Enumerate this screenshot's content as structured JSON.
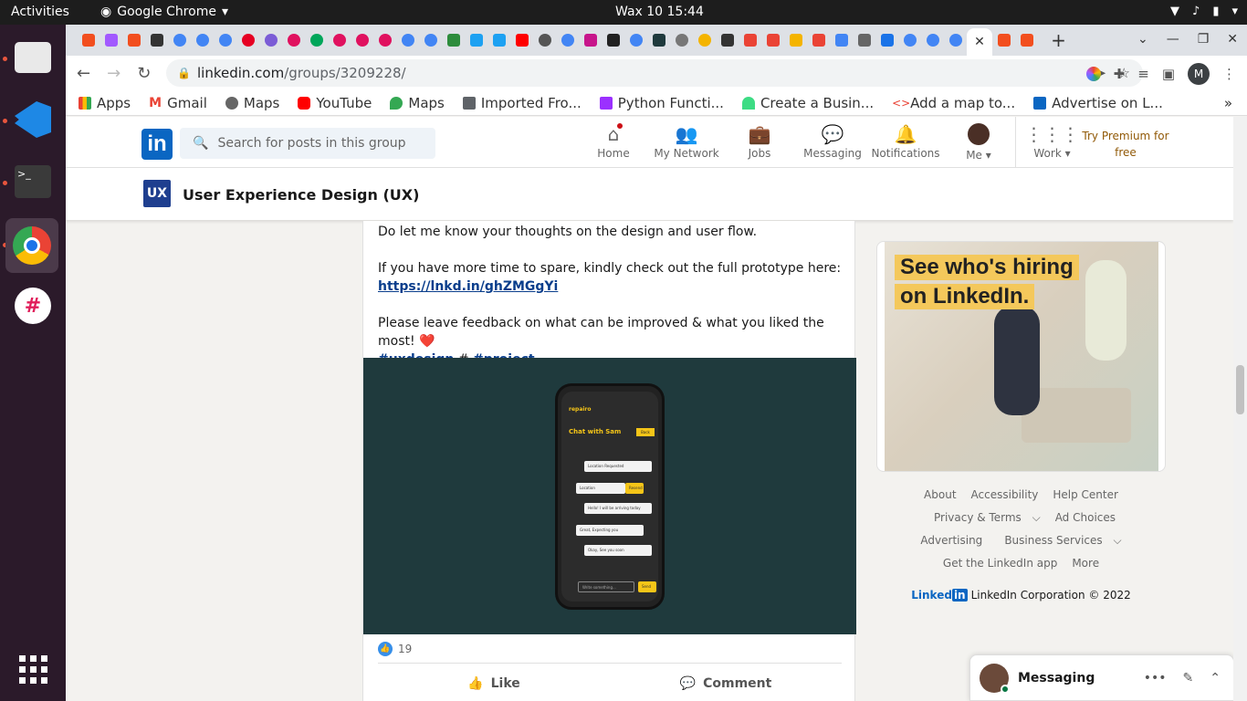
{
  "topbar": {
    "activities": "Activities",
    "app_name": "Google Chrome",
    "clock": "Wax 10  15:44"
  },
  "addressbar": {
    "url_host": "linkedin.com",
    "url_path": "/groups/3209228/",
    "profile_initial": "M"
  },
  "bookmarks": [
    {
      "label": "Apps",
      "color": "#e94235"
    },
    {
      "label": "Gmail",
      "color": "#ea4335"
    },
    {
      "label": "Maps",
      "color": "#555555"
    },
    {
      "label": "YouTube",
      "color": "#ff0000"
    },
    {
      "label": "Maps",
      "color": "#34a853"
    },
    {
      "label": "Imported Fro...",
      "color": "#5f6368"
    },
    {
      "label": "Python Functi...",
      "color": "#9b30ff"
    },
    {
      "label": "Create a Busin...",
      "color": "#3ddc84"
    },
    {
      "label": "Add a map to...",
      "color": "#e94235"
    },
    {
      "label": "Advertise on L...",
      "color": "#0a66c2"
    }
  ],
  "linkedin": {
    "search_placeholder": "Search for posts in this group",
    "nav": [
      {
        "label": "Home",
        "icon": "home-icon"
      },
      {
        "label": "My Network",
        "icon": "network-icon"
      },
      {
        "label": "Jobs",
        "icon": "jobs-icon"
      },
      {
        "label": "Messaging",
        "icon": "messaging-icon"
      },
      {
        "label": "Notifications",
        "icon": "bell-icon"
      },
      {
        "label": "Me",
        "icon": "avatar"
      },
      {
        "label": "Work",
        "icon": "grid-icon"
      }
    ],
    "premium": "Try Premium for free",
    "group_badge": "UX",
    "group_title": "User Experience Design (UX)"
  },
  "post": {
    "line1": "Do let me know your thoughts on the design and user flow.",
    "line2": "If you have more time to spare, kindly check out the full prototype here:",
    "link": "https://lnkd.in/ghZMGgYi",
    "line3": "Please leave feedback on what can be improved & what you liked the most! ❤️",
    "tag1": "#uxdesign",
    "hash": "#",
    "tag2": "#project",
    "reactions": "19",
    "like": "Like",
    "comment": "Comment",
    "phone": {
      "brand": "repairo",
      "chat_title": "Chat with Sam",
      "back": "Back",
      "bubbles": [
        "Location Requested",
        "Location",
        "Resend",
        "Hello! I will be arriving today",
        "Great, Expecting you",
        "Okay, See you soon"
      ],
      "input_placeholder": "Write something...",
      "send": "Send"
    }
  },
  "ad": {
    "line1": "See who's hiring",
    "line2": "on LinkedIn."
  },
  "footer": {
    "links": [
      "About",
      "Accessibility",
      "Help Center",
      "Privacy & Terms",
      "Ad Choices",
      "Advertising",
      "Business Services",
      "Get the LinkedIn app",
      "More"
    ],
    "brand": "Linked",
    "copyright": "LinkedIn Corporation © 2022"
  },
  "messaging": {
    "title": "Messaging"
  }
}
